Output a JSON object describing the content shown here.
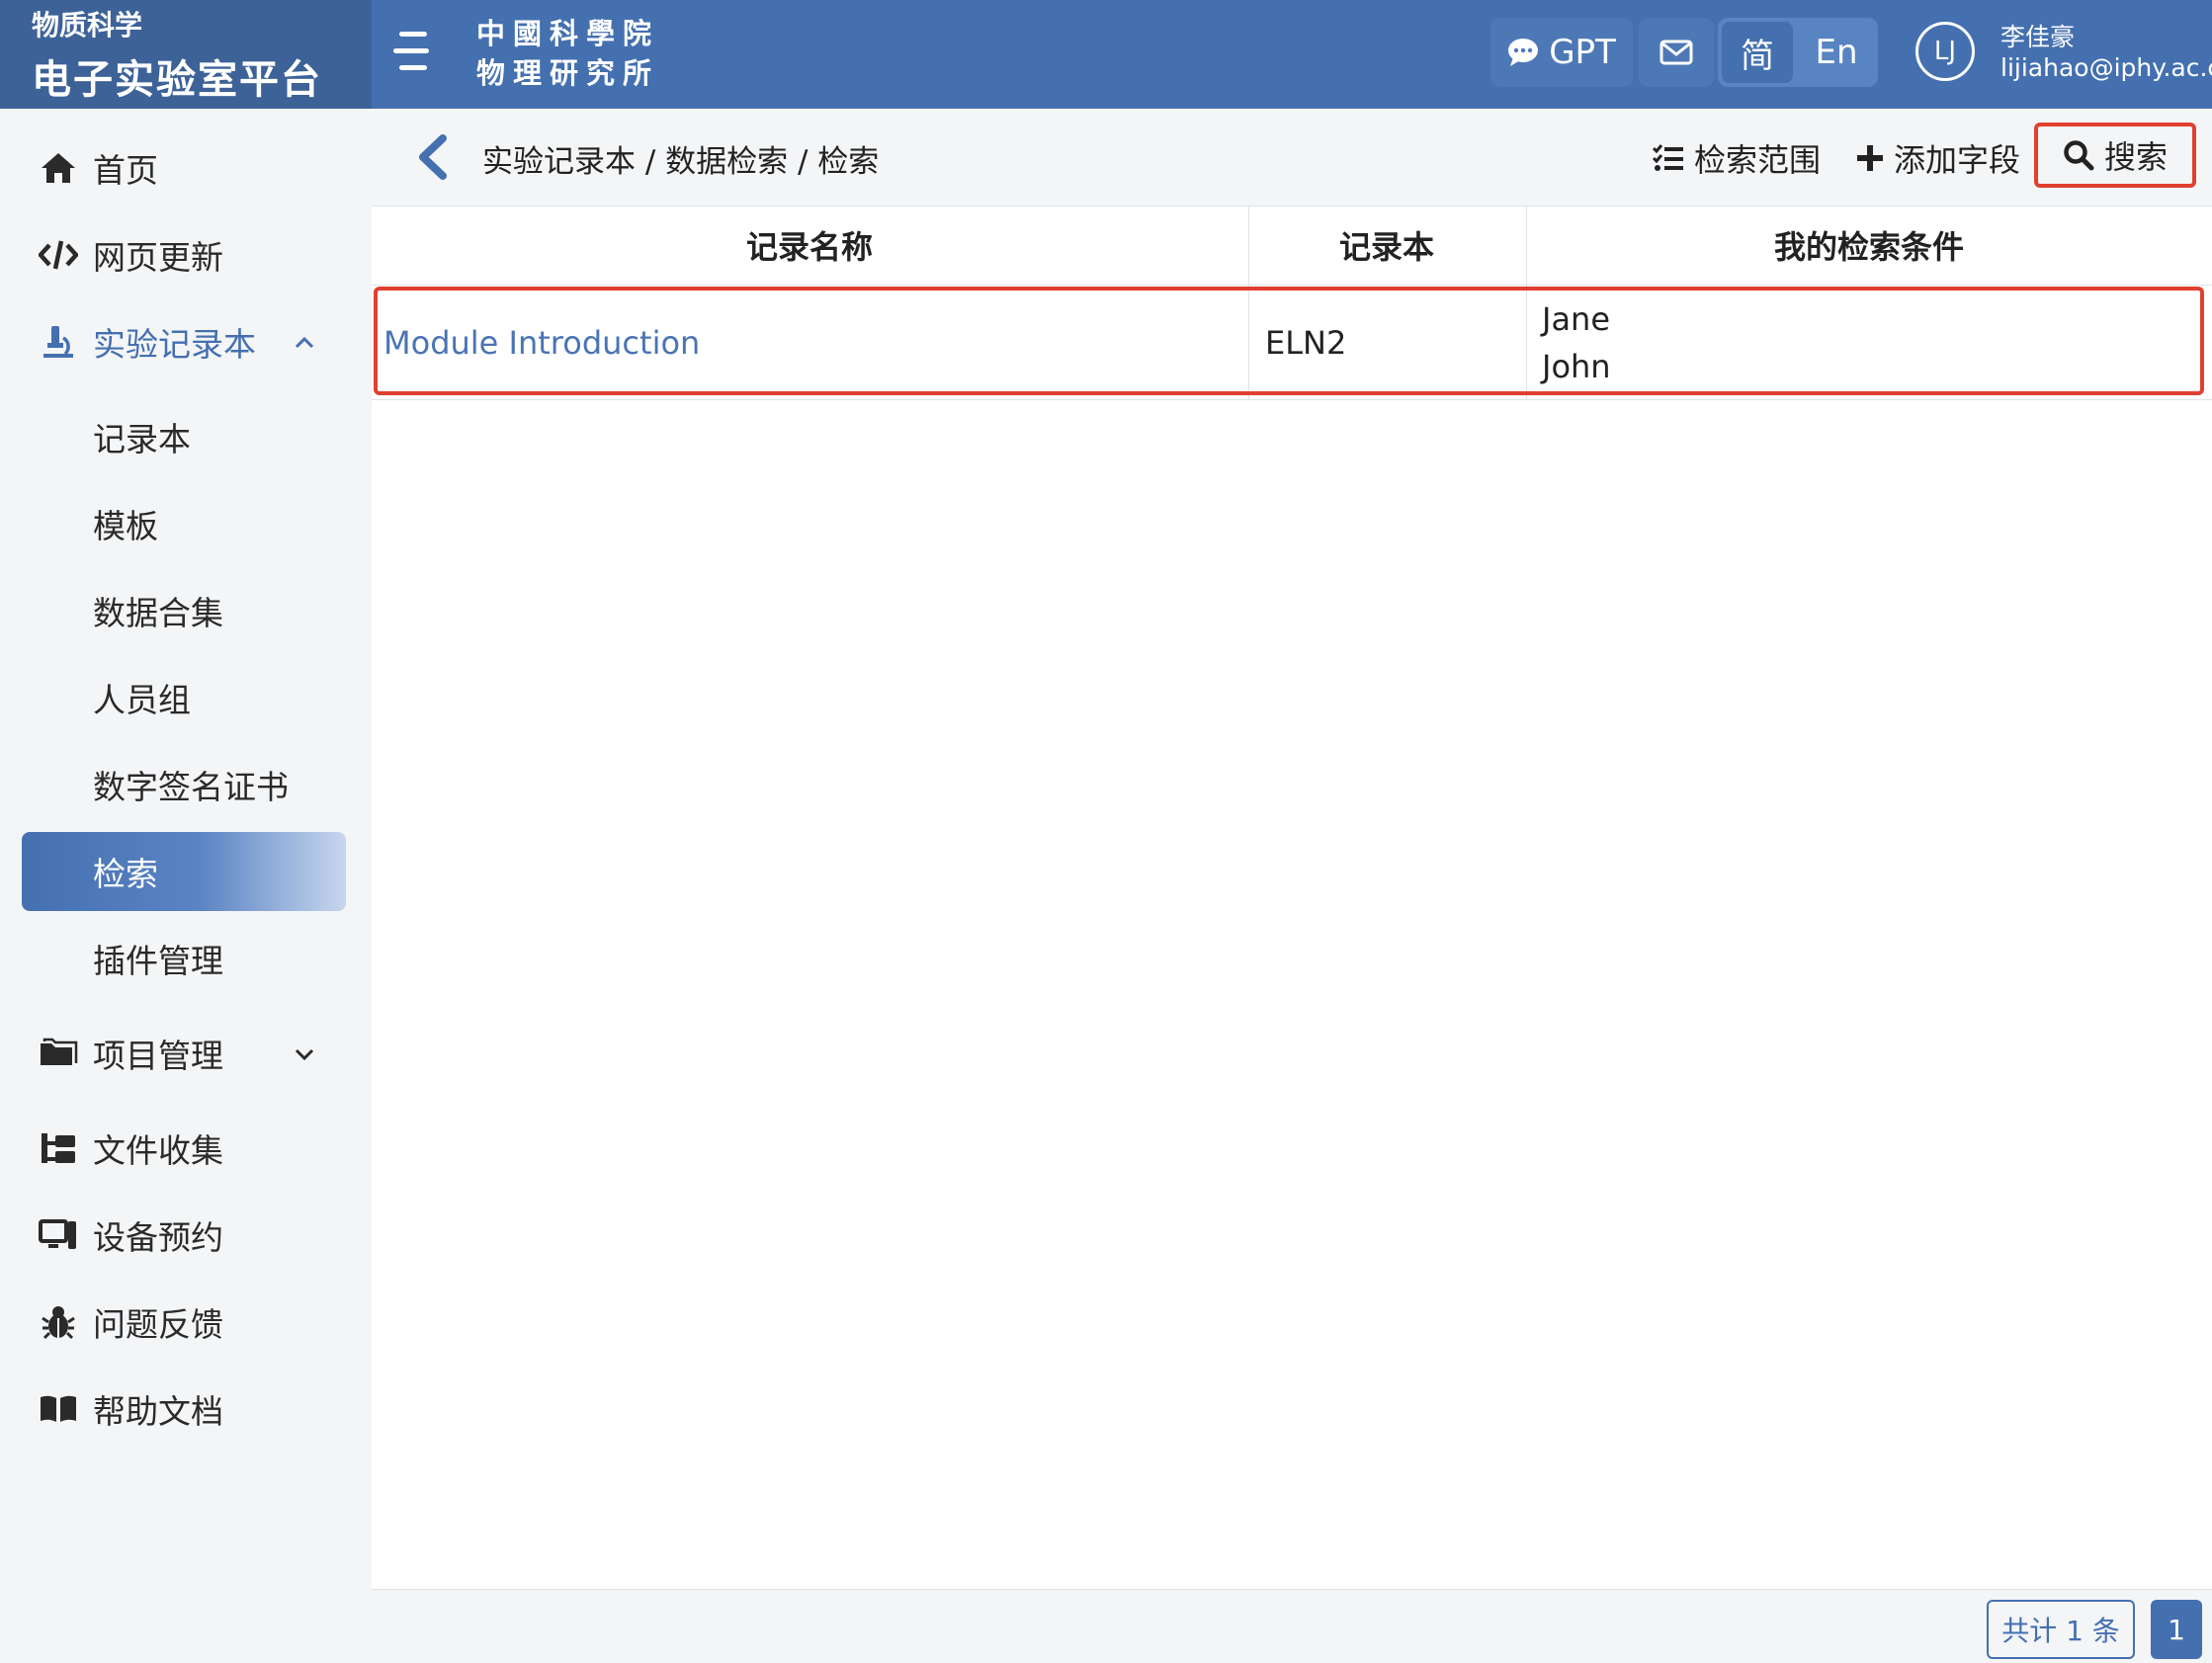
{
  "header": {
    "brand_sub": "物质科学",
    "brand_main": "电子实验室平台",
    "institute_line1": "中國科學院",
    "institute_line2": "物理研究所",
    "gpt_label": "GPT",
    "lang_zh": "简",
    "lang_en": "En",
    "avatar_initials": "LJ",
    "user_name": "李佳豪",
    "user_email": "lijiahao@iphy.ac.cn"
  },
  "sidebar": {
    "home": "首页",
    "web_update": "网页更新",
    "notebook_section": "实验记录本",
    "sub_items": [
      "记录本",
      "模板",
      "数据合集",
      "人员组",
      "数字签名证书",
      "检索",
      "插件管理"
    ],
    "project_mgmt": "项目管理",
    "file_collect": "文件收集",
    "device_booking": "设备预约",
    "feedback": "问题反馈",
    "help_docs": "帮助文档"
  },
  "toolbar": {
    "breadcrumb": "实验记录本 / 数据检索 / 检索",
    "search_scope": "检索范围",
    "add_field": "添加字段",
    "search": "搜索"
  },
  "table": {
    "columns": [
      "记录名称",
      "记录本",
      "我的检索条件"
    ],
    "rows": [
      {
        "name": "Module Introduction",
        "notebook": "ELN2",
        "conditions": [
          "Jane",
          "John"
        ]
      }
    ]
  },
  "footer": {
    "total": "共计 1 条",
    "page": "1"
  },
  "colors": {
    "header_blue": "#4470b0",
    "link_blue": "#4a74b4",
    "highlight_red": "#e0402f"
  }
}
